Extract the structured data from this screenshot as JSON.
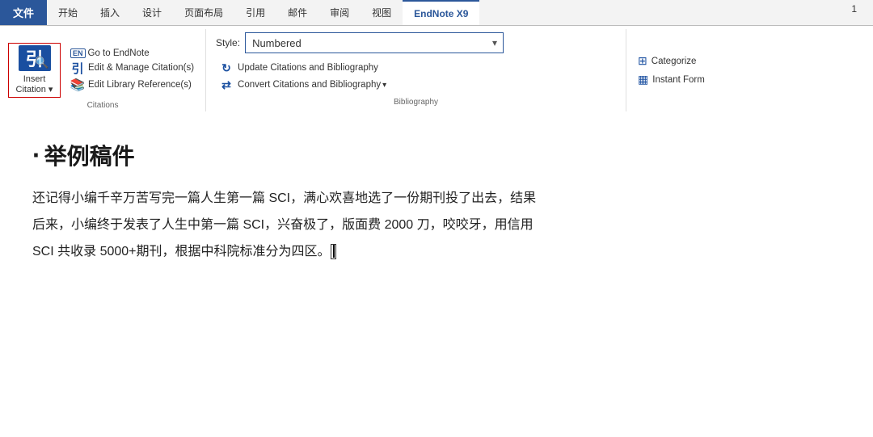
{
  "pageNumber": "1",
  "ribbon": {
    "tabs": [
      {
        "label": "文件",
        "type": "file"
      },
      {
        "label": "开始",
        "type": "normal"
      },
      {
        "label": "插入",
        "type": "normal"
      },
      {
        "label": "设计",
        "type": "normal"
      },
      {
        "label": "页面布局",
        "type": "normal"
      },
      {
        "label": "引用",
        "type": "normal"
      },
      {
        "label": "邮件",
        "type": "normal"
      },
      {
        "label": "审阅",
        "type": "normal"
      },
      {
        "label": "视图",
        "type": "normal"
      },
      {
        "label": "EndNote X9",
        "type": "endnote",
        "active": true
      }
    ]
  },
  "citations_group": {
    "label": "Citations",
    "insert_btn": {
      "label1": "Insert",
      "label2": "Citation",
      "dropdown_indicator": "▾"
    },
    "menu_items": [
      {
        "badge": "EN",
        "text": "Go to EndNote"
      },
      {
        "icon": "edit",
        "text": "Edit & Manage Citation(s)"
      },
      {
        "icon": "lib",
        "text": "Edit Library Reference(s)"
      }
    ]
  },
  "bibliography_group": {
    "label": "Bibliography",
    "style_label": "Style:",
    "style_value": "Numbered",
    "menu_items": [
      {
        "icon": "update",
        "text": "Update Citations and Bibliography"
      },
      {
        "icon": "convert",
        "text": "Convert Citations and Bibliography"
      }
    ]
  },
  "right_group": {
    "items": [
      {
        "icon": "cat",
        "text": "Categorize"
      },
      {
        "icon": "form",
        "text": "Instant Form"
      }
    ]
  },
  "document": {
    "title": "举例稿件",
    "paragraphs": [
      "还记得小编千辛万苦写完一篇人生第一篇 SCI，满心欢喜地选了一份期刊投了出去，结果",
      "后来，小编终于发表了人生中第一篇 SCI，兴奋极了，版面费 2000 刀，咬咬牙，用信用",
      "SCI 共收录 5000+期刊，根据中科院标准分为四区。"
    ],
    "cursor_position": "after_paragraph_3"
  }
}
